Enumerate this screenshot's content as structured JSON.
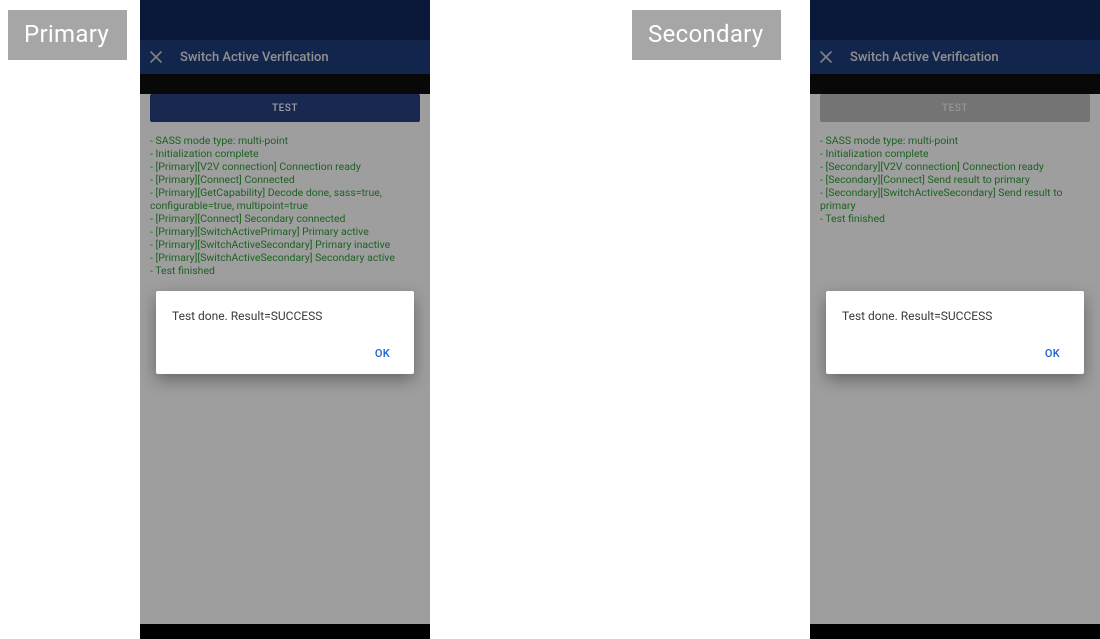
{
  "badges": {
    "primary": "Primary",
    "secondary": "Secondary"
  },
  "appbar": {
    "title": "Switch Active Verification"
  },
  "test_button": {
    "label": "TEST"
  },
  "primary": {
    "logs": [
      "- SASS mode type: multi-point",
      "- Initialization complete",
      "- [Primary][V2V connection] Connection ready",
      "- [Primary][Connect] Connected",
      "- [Primary][GetCapability] Decode done, sass=true, configurable=true, multipoint=true",
      "- [Primary][Connect] Secondary connected",
      "- [Primary][SwitchActivePrimary] Primary active",
      "- [Primary][SwitchActiveSecondary] Primary inactive",
      "- [Primary][SwitchActiveSecondary] Secondary active",
      "- Test finished"
    ]
  },
  "secondary": {
    "logs": [
      "- SASS mode type: multi-point",
      "- Initialization complete",
      "- [Secondary][V2V connection] Connection ready",
      "- [Secondary][Connect] Send result to primary",
      "- [Secondary][SwitchActiveSecondary] Send result to primary",
      "- Test finished"
    ]
  },
  "dialog": {
    "message": "Test done. Result=SUCCESS",
    "ok": "OK"
  }
}
